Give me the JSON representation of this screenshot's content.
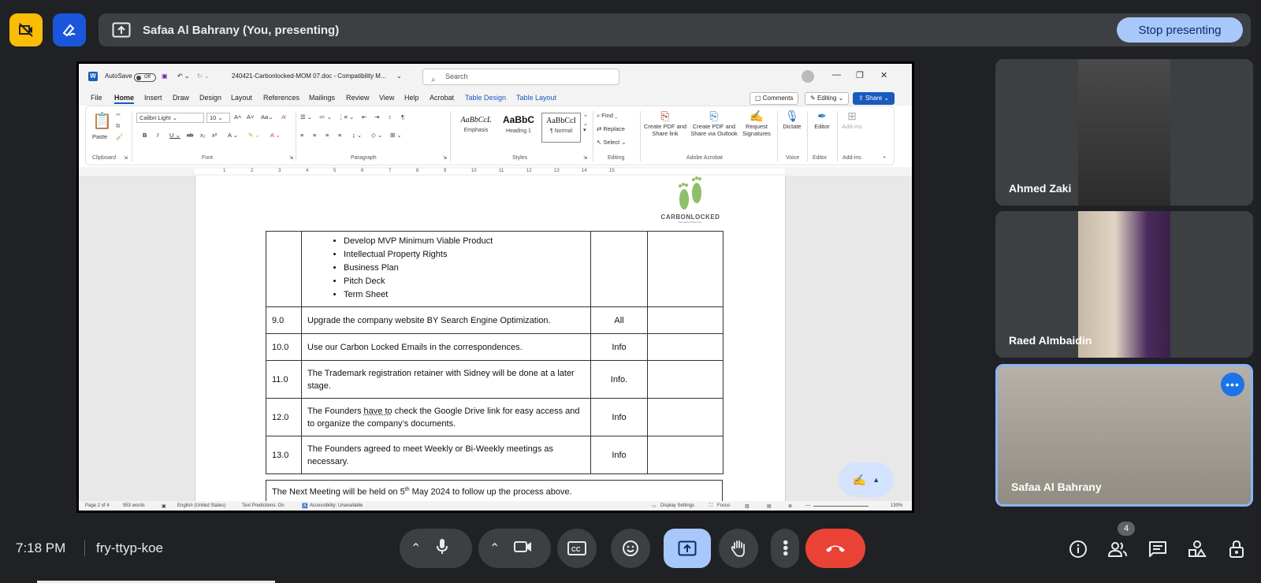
{
  "top_bar": {
    "presenter_text": "Safaa Al Bahrany (You, presenting)",
    "stop_label": "Stop presenting"
  },
  "word": {
    "autosave": "AutoSave",
    "autosave_state": "Off",
    "filename": "240421-Carbonlocked-MOM 07.doc  -  Compatibility M...",
    "search_placeholder": "Search",
    "tabs": [
      "File",
      "Home",
      "Insert",
      "Draw",
      "Design",
      "Layout",
      "References",
      "Mailings",
      "Review",
      "View",
      "Help",
      "Acrobat",
      "Table Design",
      "Table Layout"
    ],
    "comments": "Comments",
    "editing": "Editing",
    "share": "Share",
    "ribbon": {
      "paste": "Paste",
      "clipboard": "Clipboard",
      "font_name": "Calibri Light",
      "font_size": "10",
      "font": "Font",
      "paragraph": "Paragraph",
      "styles": "Styles",
      "style_emphasis_sample": "AaBbCcL",
      "style_emphasis": "Emphasis",
      "style_h1_sample": "AaBbC",
      "style_h1": "Heading 1",
      "style_normal_sample": "AaBbCcI",
      "style_normal": "¶ Normal",
      "find": "Find",
      "replace": "Replace",
      "select": "Select",
      "editing_group": "Editing",
      "create_pdf": "Create PDF and Share link",
      "create_pdf_outlook": "Create PDF and Share via Outlook",
      "request_sig": "Request Signatures",
      "acrobat_group": "Adobe Acrobat",
      "dictate": "Dictate",
      "voice": "Voice",
      "editor": "Editor",
      "editor_group": "Editor",
      "addins": "Add-ins",
      "addins_group": "Add-ins"
    },
    "ruler_numbers": [
      "1",
      "2",
      "3",
      "4",
      "5",
      "6",
      "7",
      "8",
      "9",
      "10",
      "11",
      "12",
      "13",
      "14",
      "15"
    ],
    "logo_text": "CARBONLOCKED",
    "logo_sub": "TECHNOLOGIES INC.",
    "bullets": [
      "Develop MVP Minimum Viable Product",
      "Intellectual Property Rights",
      "Business Plan",
      "Pitch Deck",
      "Term Sheet"
    ],
    "rows": [
      {
        "num": "9.0",
        "desc": "Upgrade the company website BY Search Engine Optimization.",
        "resp": "All"
      },
      {
        "num": "10.0",
        "desc": "Use our Carbon Locked Emails in the correspondences.",
        "resp": "Info"
      },
      {
        "num": "11.0",
        "desc": "The Trademark registration retainer with Sidney will be done at a later stage.",
        "resp": "Info."
      },
      {
        "num": "12.0",
        "desc_a": "The Founders ",
        "desc_b": "have to",
        "desc_c": " check the Google Drive link for easy access and to organize the company’s documents.",
        "resp": "Info"
      },
      {
        "num": "13.0",
        "desc": "The Founders agreed to meet Weekly or Bi-Weekly meetings as necessary.",
        "resp": "Info"
      }
    ],
    "next_meeting_a": "The Next Meeting will be held on 5",
    "next_meeting_sup": "th",
    "next_meeting_b": " May 2024 to follow up the process above.",
    "status": {
      "page": "Page 2 of 4",
      "words": "953 words",
      "language": "English (United States)",
      "predictions": "Text Predictions: On",
      "accessibility": "Accessibility: Unavailable",
      "display": "Display Settings",
      "focus": "Focus",
      "zoom": "130%"
    }
  },
  "participants": [
    {
      "name": "Ahmed Zaki"
    },
    {
      "name": "Raed Almbaidin"
    },
    {
      "name": "Safaa Al Bahrany"
    }
  ],
  "bottom": {
    "time": "7:18 PM",
    "code": "fry-ttyp-koe",
    "people_count": "4"
  }
}
